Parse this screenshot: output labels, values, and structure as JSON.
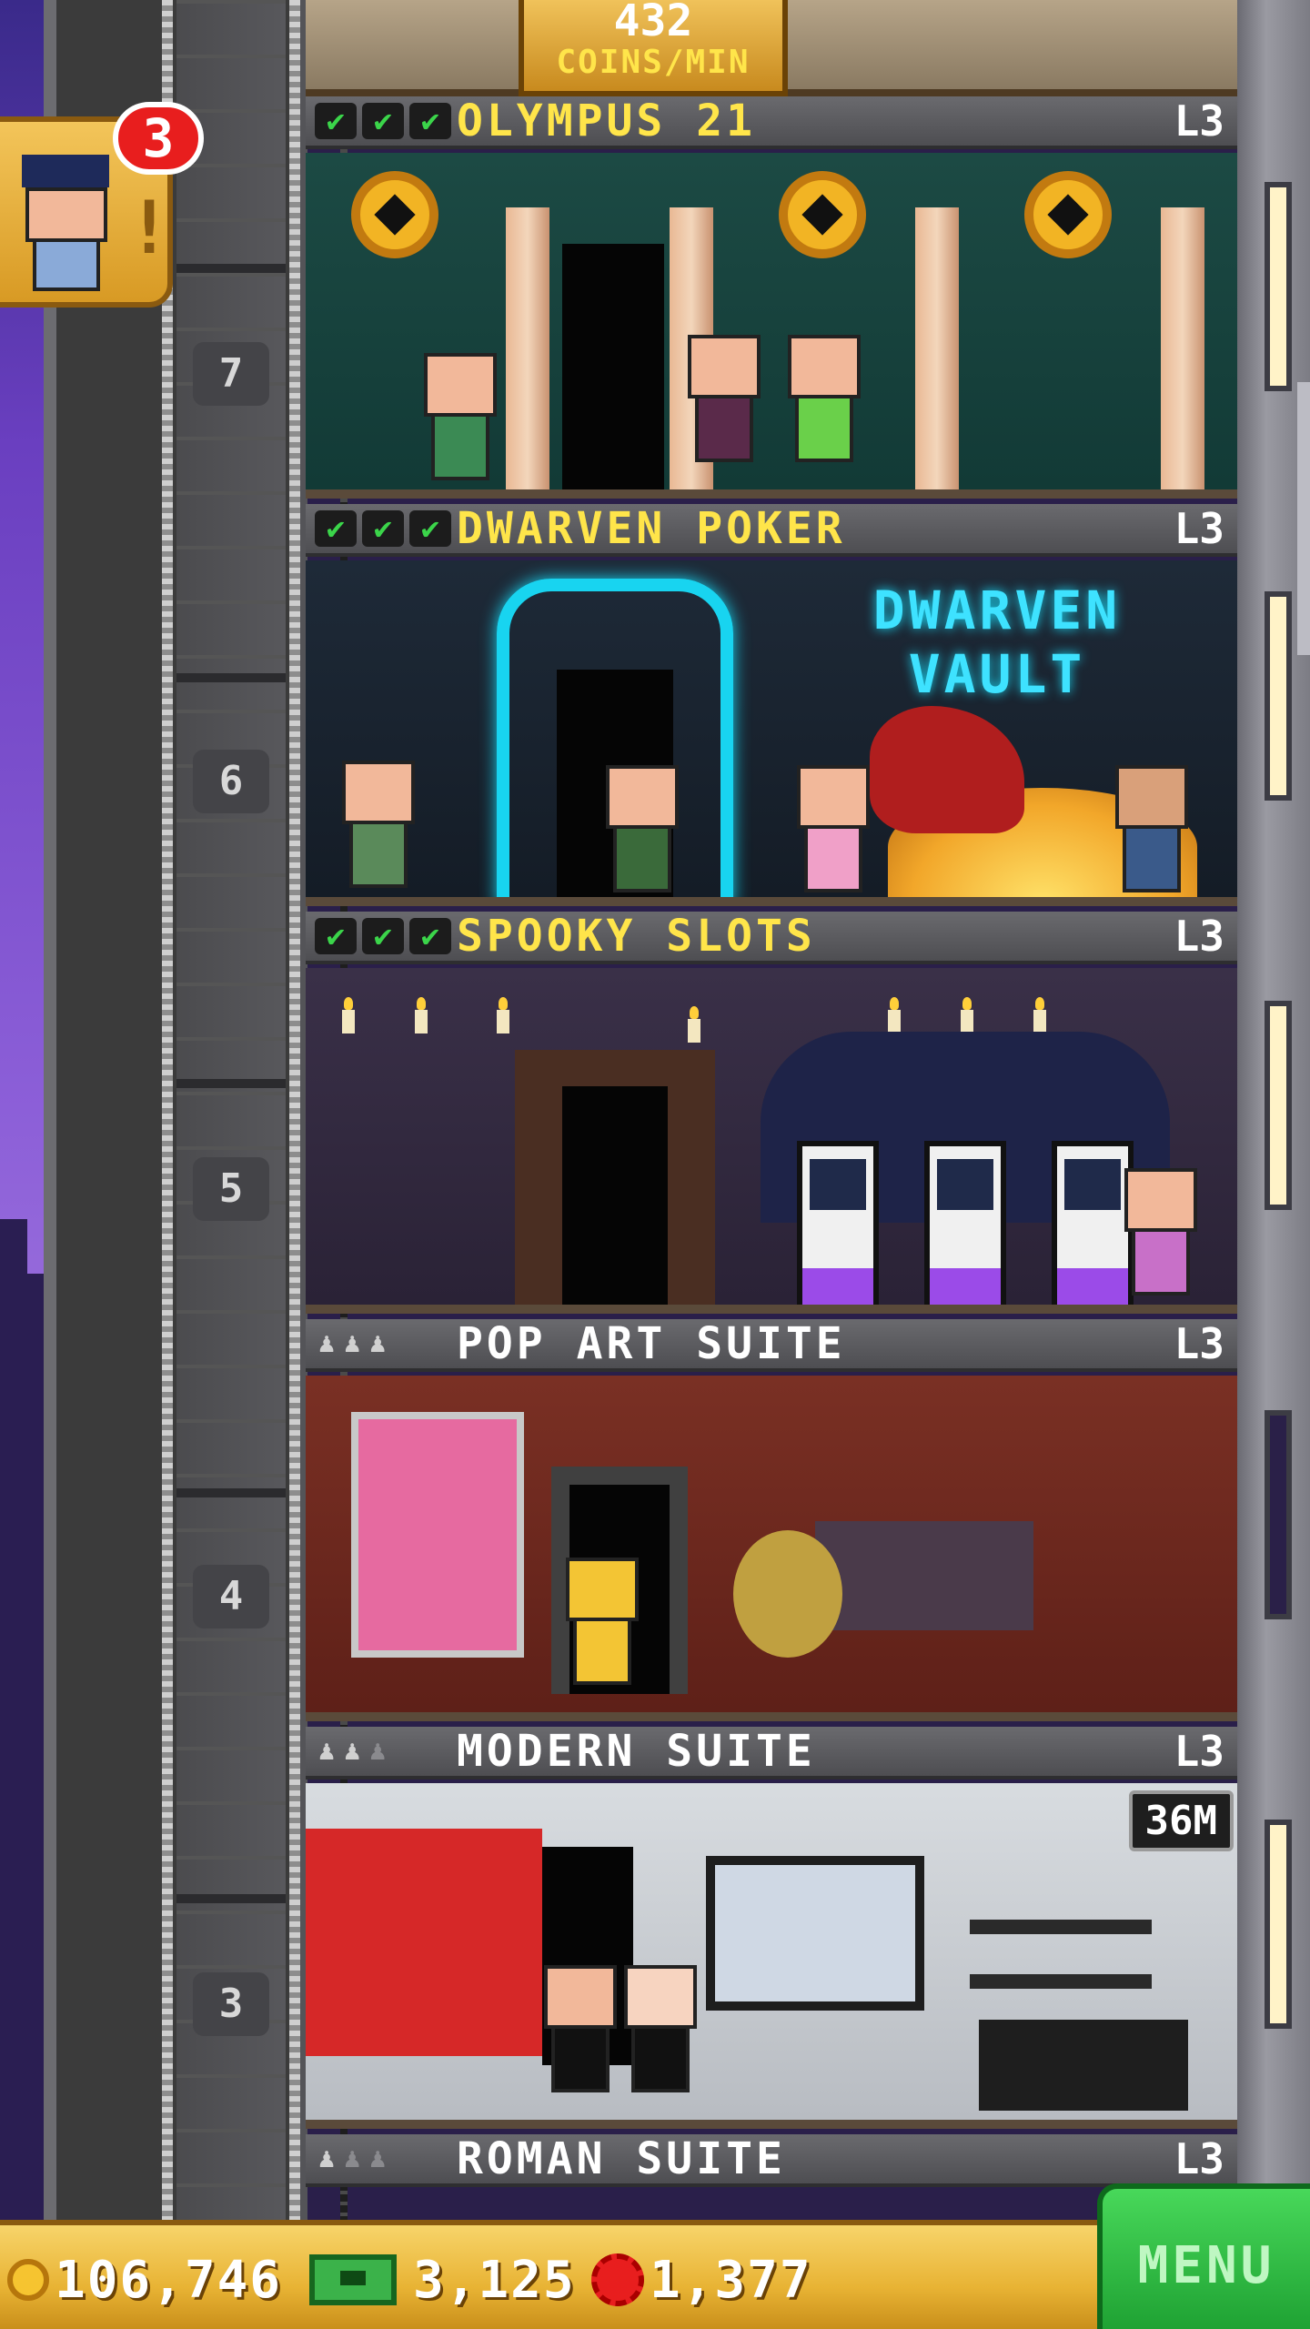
{
  "income": {
    "value": "432",
    "unit": "COINS/MIN"
  },
  "notification": {
    "count": "3",
    "icon": "doorman-avatar-icon"
  },
  "elevator": {
    "floor_numbers": [
      "7",
      "6",
      "5",
      "4",
      "3"
    ]
  },
  "floors": [
    {
      "id": "olympus",
      "title": "OLYMPUS 21",
      "level": "L3",
      "status": "stocked",
      "checks": [
        "✔",
        "✔",
        "✔"
      ]
    },
    {
      "id": "dwarven",
      "title": "DWARVEN POKER",
      "level": "L3",
      "status": "stocked",
      "checks": [
        "✔",
        "✔",
        "✔"
      ],
      "sign": "DWARVEN VAULT"
    },
    {
      "id": "spooky",
      "title": "SPOOKY SLOTS",
      "level": "L3",
      "status": "stocked",
      "checks": [
        "✔",
        "✔",
        "✔"
      ]
    },
    {
      "id": "popart",
      "title": "POP ART SUITE",
      "level": "L3",
      "status": "residential",
      "residents": [
        "♟",
        "♟",
        "♟"
      ]
    },
    {
      "id": "modern",
      "title": "MODERN SUITE",
      "level": "L3",
      "status": "residential",
      "residents": [
        "♟",
        "♟",
        "♟"
      ],
      "price_tag": "36M"
    },
    {
      "id": "roman",
      "title": "ROMAN SUITE",
      "level": "L3",
      "status": "residential",
      "residents": [
        "♟",
        "♟",
        "♟"
      ]
    }
  ],
  "bottom_bar": {
    "coins": "106,746",
    "bux": "3,125",
    "chips": "1,377",
    "menu_label": "MENU"
  },
  "colors": {
    "lit_title": "#ffe54a",
    "plain_title": "#ffffff",
    "check_green": "#3bd54a",
    "menu_green": "#2fbe42",
    "badge_red": "#e81e1e"
  }
}
